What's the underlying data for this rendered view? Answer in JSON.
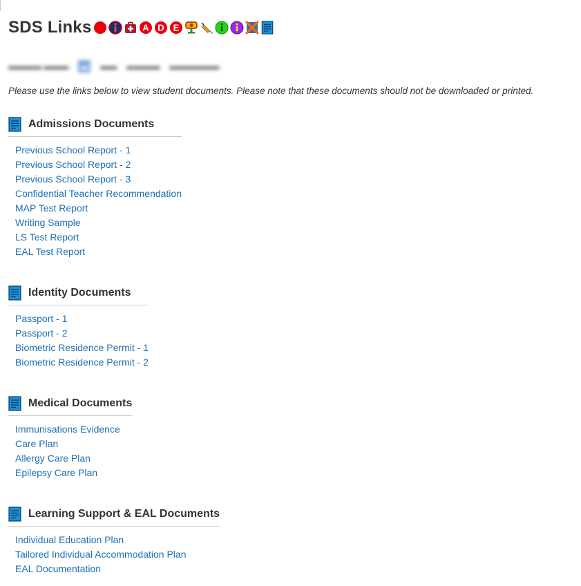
{
  "header": {
    "title": "SDS Links",
    "status_icons": [
      "red-circle-icon",
      "info-badge-icon",
      "medical-kit-icon",
      "red-a-icon",
      "red-d-icon",
      "red-e-icon",
      "award-icon",
      "syringe-icon",
      "green-info-icon",
      "purple-info-icon",
      "crossed-out-icon",
      "document-icon"
    ]
  },
  "notice": "Please use the links below to view student documents. Please note that these documents should not be downloaded or printed.",
  "sections": [
    {
      "title": "Admissions Documents",
      "links": [
        "Previous School Report - 1",
        "Previous School Report - 2",
        "Previous School Report - 3",
        "Confidential Teacher Recommendation",
        "MAP Test Report",
        "Writing Sample",
        "LS Test Report",
        "EAL Test Report"
      ]
    },
    {
      "title": "Identity Documents",
      "links": [
        "Passport - 1",
        "Passport - 2",
        "Biometric Residence Permit - 1",
        "Biometric Residence Permit - 2"
      ]
    },
    {
      "title": "Medical Documents",
      "links": [
        "Immunisations Evidence",
        "Care Plan",
        "Allergy Care Plan",
        "Epilepsy Care Plan"
      ]
    },
    {
      "title": "Learning Support & EAL Documents",
      "links": [
        "Individual Education Plan",
        "Tailored Individual Accommodation Plan",
        "EAL Documentation"
      ]
    }
  ],
  "colors": {
    "link": "#1f6fb2",
    "heading": "#333333",
    "divider": "#cccccc",
    "doc_icon": "#1a8fd6"
  }
}
